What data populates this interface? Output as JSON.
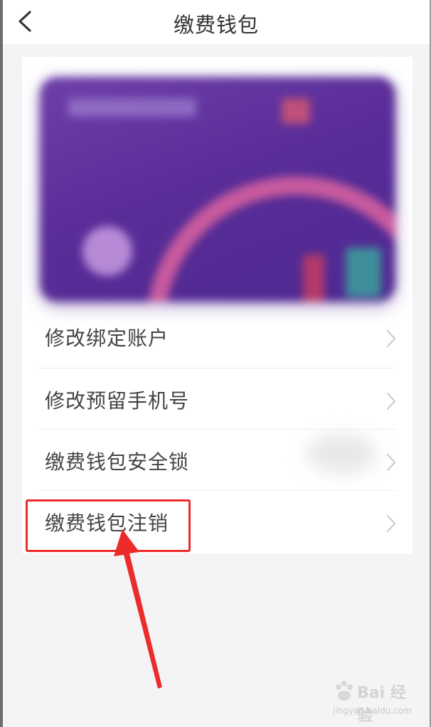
{
  "header": {
    "title": "缴费钱包"
  },
  "menu": {
    "items": [
      {
        "label": "修改绑定账户"
      },
      {
        "label": "修改预留手机号"
      },
      {
        "label": "缴费钱包安全锁"
      },
      {
        "label": "缴费钱包注销"
      }
    ]
  },
  "watermark": {
    "brand": "Bai 经验",
    "url": "jingyan.baidu.com"
  },
  "colors": {
    "card": "#5a2d98",
    "highlight": "#ec2b2b",
    "background": "#f4f4f6"
  }
}
